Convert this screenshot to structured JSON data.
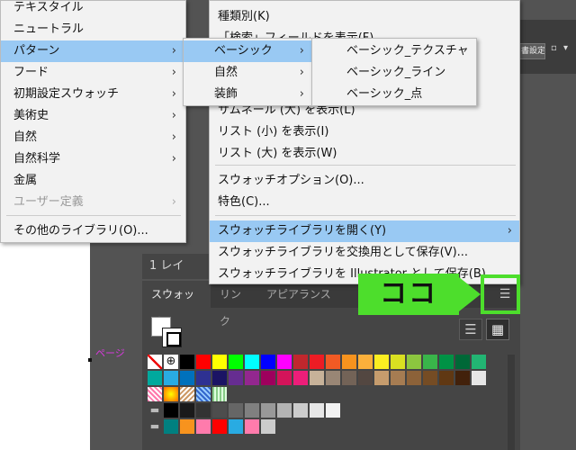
{
  "app": {
    "strip_button_label": "書設定",
    "layer_bar_label": "1 レイ",
    "artboard_label": "ページ"
  },
  "panel": {
    "tabs": [
      "スウォッチ",
      "リンク",
      "アピアランス"
    ],
    "menu_icon": "hamburger-menu-icon",
    "view_list_icon": "list-view-icon",
    "view_grid_icon": "grid-view-icon"
  },
  "swatches": {
    "row1": [
      "#ffffff",
      "#ffffff",
      "#000000",
      "#ff0000",
      "#ffff00",
      "#00ff00",
      "#00ffff",
      "#0000ff",
      "#ff00ff",
      "#c1272d",
      "#ed1c24",
      "#f15a24",
      "#f7931e",
      "#fbb03b",
      "#fcee21",
      "#d9e021",
      "#8cc63f",
      "#39b54a",
      "#009245",
      "#006837",
      "#22b573"
    ],
    "row2": [
      "#00a99d",
      "#29abe2",
      "#0071bc",
      "#2e3192",
      "#1b1464",
      "#662d91",
      "#93278f",
      "#9e005d",
      "#d4145a",
      "#ed1e79",
      "#c7b299",
      "#998675",
      "#736357",
      "#534741",
      "#c69c6d",
      "#a67c52",
      "#8c6239",
      "#754c24",
      "#603813",
      "#42210b",
      "#e6e6e6"
    ],
    "row4": [
      "#000000",
      "#1a1a1a",
      "#333333",
      "#4d4d4d",
      "#666666",
      "#808080",
      "#999999",
      "#b3b3b3",
      "#cccccc",
      "#e6e6e6",
      "#f2f2f2"
    ],
    "row5": [
      "#008080",
      "#f7931e",
      "#ff7bac",
      "#ff0000",
      "#29abe2",
      "#ff7bac",
      "#cccccc"
    ]
  },
  "menu_left": {
    "items": [
      {
        "label": "テキスタイル",
        "arrow": "",
        "state": "normal"
      },
      {
        "label": "ニュートラル",
        "arrow": "",
        "state": "normal"
      },
      {
        "label": "パターン",
        "arrow": "›",
        "state": "highlight"
      },
      {
        "label": "フード",
        "arrow": "›",
        "state": "normal"
      },
      {
        "label": "初期設定スウォッチ",
        "arrow": "›",
        "state": "normal"
      },
      {
        "label": "美術史",
        "arrow": "›",
        "state": "normal"
      },
      {
        "label": "自然",
        "arrow": "›",
        "state": "normal"
      },
      {
        "label": "自然科学",
        "arrow": "›",
        "state": "normal"
      },
      {
        "label": "金属",
        "arrow": "",
        "state": "normal"
      },
      {
        "label": "ユーザー定義",
        "arrow": "›",
        "state": "disabled"
      },
      {
        "label": "その他のライブラリ(O)...",
        "arrow": "",
        "state": "normal"
      }
    ]
  },
  "menu_main": {
    "items": [
      {
        "label": "種類別(K)",
        "arrow": ""
      },
      {
        "label": "「検索」フィールドを表示(F)",
        "arrow": ""
      },
      {
        "label": "サムネール (大) を表示(L)",
        "arrow": ""
      },
      {
        "label": "リスト (小) を表示(I)",
        "arrow": ""
      },
      {
        "label": "リスト (大) を表示(W)",
        "arrow": ""
      },
      {
        "label": "スウォッチオプション(O)...",
        "arrow": ""
      },
      {
        "label": "特色(C)...",
        "arrow": ""
      },
      {
        "label": "スウォッチライブラリを開く(Y)",
        "arrow": "›"
      },
      {
        "label": "スウォッチライブラリを交換用として保存(V)...",
        "arrow": ""
      },
      {
        "label": "スウォッチライブラリを Illustrator として保存(B)...",
        "arrow": ""
      }
    ]
  },
  "menu_sub": {
    "items": [
      {
        "label": "ベーシック",
        "arrow": "›"
      },
      {
        "label": "自然",
        "arrow": "›"
      },
      {
        "label": "装飾",
        "arrow": "›"
      }
    ]
  },
  "menu_sub2": {
    "items": [
      "ベーシック_テクスチャ",
      "ベーシック_ライン",
      "ベーシック_点"
    ]
  },
  "annotation": {
    "text": "ココ",
    "color": "#4dde2c"
  }
}
